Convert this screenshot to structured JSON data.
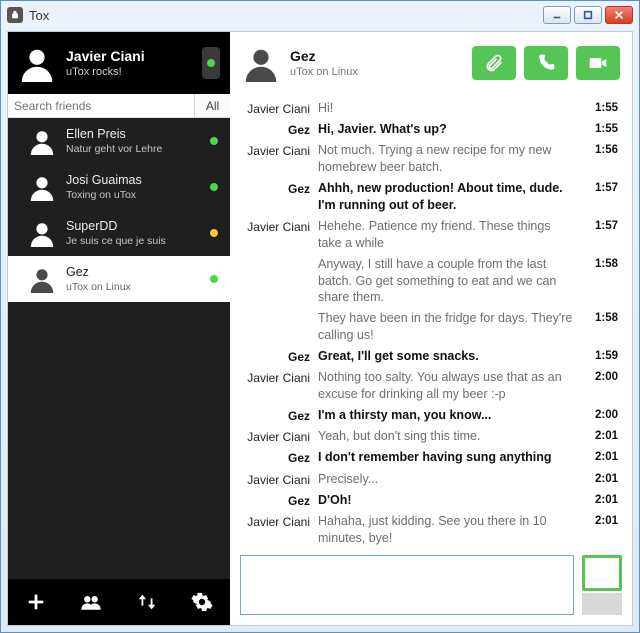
{
  "window": {
    "title": "Tox"
  },
  "colors": {
    "accent": "#55c555"
  },
  "profile": {
    "name": "Javier Ciani",
    "status": "uTox rocks!",
    "presence": "online"
  },
  "search": {
    "placeholder": "Search friends",
    "filter_label": "All"
  },
  "friends": [
    {
      "name": "Ellen Preis",
      "sub": "Natur geht vor Lehre",
      "presence": "online",
      "selected": false
    },
    {
      "name": "Josi Guaimas",
      "sub": "Toxing on uTox",
      "presence": "online",
      "selected": false
    },
    {
      "name": "SuperDD",
      "sub": "Je suis ce que je suis",
      "presence": "away",
      "selected": false
    },
    {
      "name": "Gez",
      "sub": "uTox on Linux",
      "presence": "online",
      "selected": true
    }
  ],
  "sidebar_buttons": [
    "add",
    "group",
    "transfer",
    "settings"
  ],
  "chat": {
    "peer": {
      "name": "Gez",
      "sub": "uTox on Linux"
    },
    "actions": [
      "attach",
      "voice-call",
      "video-call"
    ],
    "messages": [
      {
        "who": "Javier Ciani",
        "mine": true,
        "text": "Hi!",
        "time": "1:55"
      },
      {
        "who": "Gez",
        "mine": false,
        "text": "Hi, Javier. What's up?",
        "time": "1:55"
      },
      {
        "who": "Javier Ciani",
        "mine": true,
        "text": "Not much. Trying a new recipe for my new homebrew beer batch.",
        "time": "1:56"
      },
      {
        "who": "Gez",
        "mine": false,
        "text": "Ahhh, new production! About time, dude. I'm running out of beer.",
        "time": "1:57"
      },
      {
        "who": "Javier Ciani",
        "mine": true,
        "text": "Hehehe. Patience my friend. These things take a while",
        "time": "1:57"
      },
      {
        "who": "",
        "mine": true,
        "text": "Anyway, I still have a couple from the last batch. Go get something to eat and we can share them.",
        "time": "1:58"
      },
      {
        "who": "",
        "mine": true,
        "text": "They have been in the fridge for days. They're calling us!",
        "time": "1:58"
      },
      {
        "who": "Gez",
        "mine": false,
        "text": "Great, I'll get some snacks.",
        "time": "1:59"
      },
      {
        "who": "Javier Ciani",
        "mine": true,
        "text": "Nothing too salty. You always use that as an excuse for drinking all my beer :-p",
        "time": "2:00"
      },
      {
        "who": "Gez",
        "mine": false,
        "text": "I'm a thirsty man, you know...",
        "time": "2:00"
      },
      {
        "who": "Javier Ciani",
        "mine": true,
        "text": "Yeah, but don't sing this time.",
        "time": "2:01"
      },
      {
        "who": "Gez",
        "mine": false,
        "text": "I don't remember having sung anything",
        "time": "2:01"
      },
      {
        "who": "Javier Ciani",
        "mine": true,
        "text": "Precisely...",
        "time": "2:01"
      },
      {
        "who": "Gez",
        "mine": false,
        "text": "D'Oh!",
        "time": "2:01"
      },
      {
        "who": "Javier Ciani",
        "mine": true,
        "text": "Hahaha, just kidding. See you there in 10 minutes, bye!",
        "time": "2:01"
      }
    ],
    "compose_value": ""
  }
}
